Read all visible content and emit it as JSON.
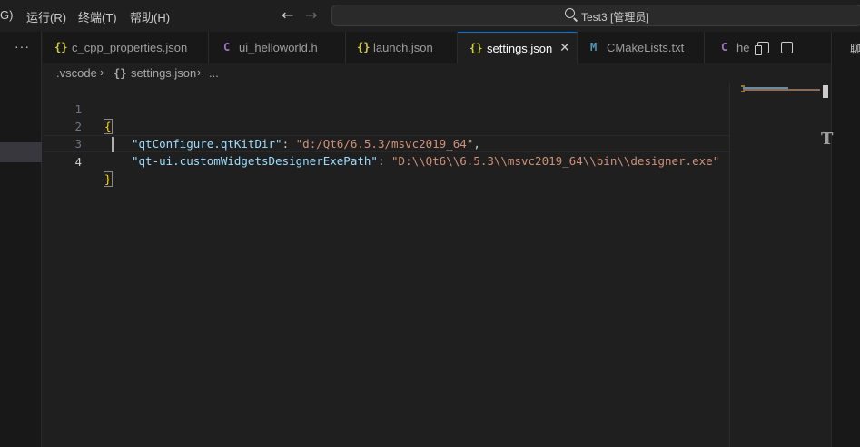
{
  "menubar": {
    "items": [
      {
        "label": "G)"
      },
      {
        "label": "运行(R)"
      },
      {
        "label": "终端(T)"
      },
      {
        "label": "帮助(H)"
      }
    ]
  },
  "nav": {
    "back": "←",
    "forward": "→"
  },
  "search": {
    "text": "Test3 [管理员]"
  },
  "explorer": {
    "more": "···"
  },
  "tabs": [
    {
      "icon": "{}",
      "icon_type": "json",
      "label": "c_cpp_properties.json"
    },
    {
      "icon": "C",
      "icon_type": "c",
      "label": "ui_helloworld.h"
    },
    {
      "icon": "{}",
      "icon_type": "json",
      "label": "launch.json"
    },
    {
      "icon": "{}",
      "icon_type": "json",
      "label": "settings.json",
      "active": true,
      "close": "✕"
    },
    {
      "icon": "M",
      "icon_type": "cmake",
      "label": "CMakeLists.txt"
    },
    {
      "icon": "C",
      "icon_type": "c",
      "label": "he"
    }
  ],
  "breadcrumb": {
    "folder": ".vscode",
    "file_icon": "{}",
    "file": "settings.json",
    "more": "...",
    "sep": "›"
  },
  "editor": {
    "lines": [
      {
        "num": "1",
        "brace": "{"
      },
      {
        "num": "2",
        "key": "\"qtConfigure.qtKitDir\"",
        "colon": ": ",
        "value": "\"d:/Qt6/6.5.3/msvc2019_64\"",
        "tail": ","
      },
      {
        "num": "3",
        "key": "\"qt-ui.customWidgetsDesignerExePath\"",
        "colon": ": ",
        "value": "\"D:\\\\Qt6\\\\6.5.3\\\\msvc2019_64\\\\bin\\\\designer.exe\"",
        "tail": ""
      },
      {
        "num": "4",
        "brace": "}"
      }
    ]
  },
  "right_panel": {
    "label": "聊"
  },
  "colors": {
    "accent": "#0078d4",
    "json_icon": "#cbcb41",
    "c_icon": "#a074c4",
    "cmake_icon": "#519aba",
    "json_key": "#9cdcfe",
    "json_string": "#ce9178",
    "bracket": "#ffd700"
  }
}
